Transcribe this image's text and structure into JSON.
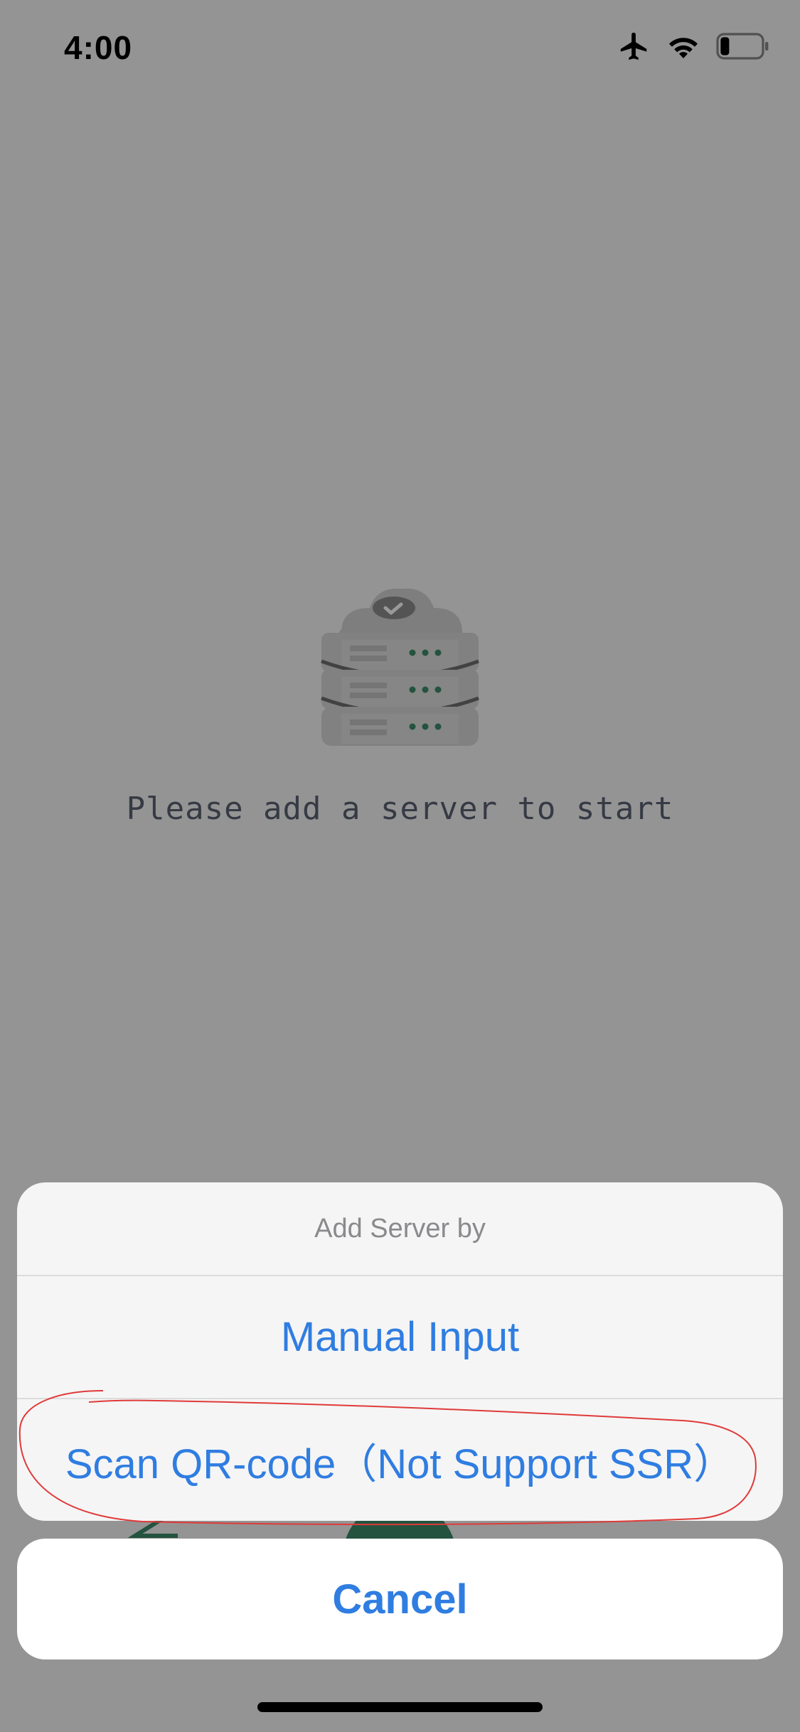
{
  "status_bar": {
    "time": "4:00",
    "icons": [
      "airplane-icon",
      "wifi-icon",
      "battery-icon"
    ],
    "battery_level": 0.2
  },
  "main": {
    "empty_state_icon": "server-stack-icon",
    "empty_state_text": "Please add a server to start"
  },
  "action_sheet": {
    "title": "Add Server by",
    "options": [
      {
        "label": "Manual Input"
      },
      {
        "label": "Scan QR-code（Not Support SSR）"
      }
    ],
    "cancel_label": "Cancel"
  },
  "colors": {
    "accent": "#2f7de1",
    "annotation": "#e03a3a",
    "server_dots": "#3c8a6a"
  }
}
